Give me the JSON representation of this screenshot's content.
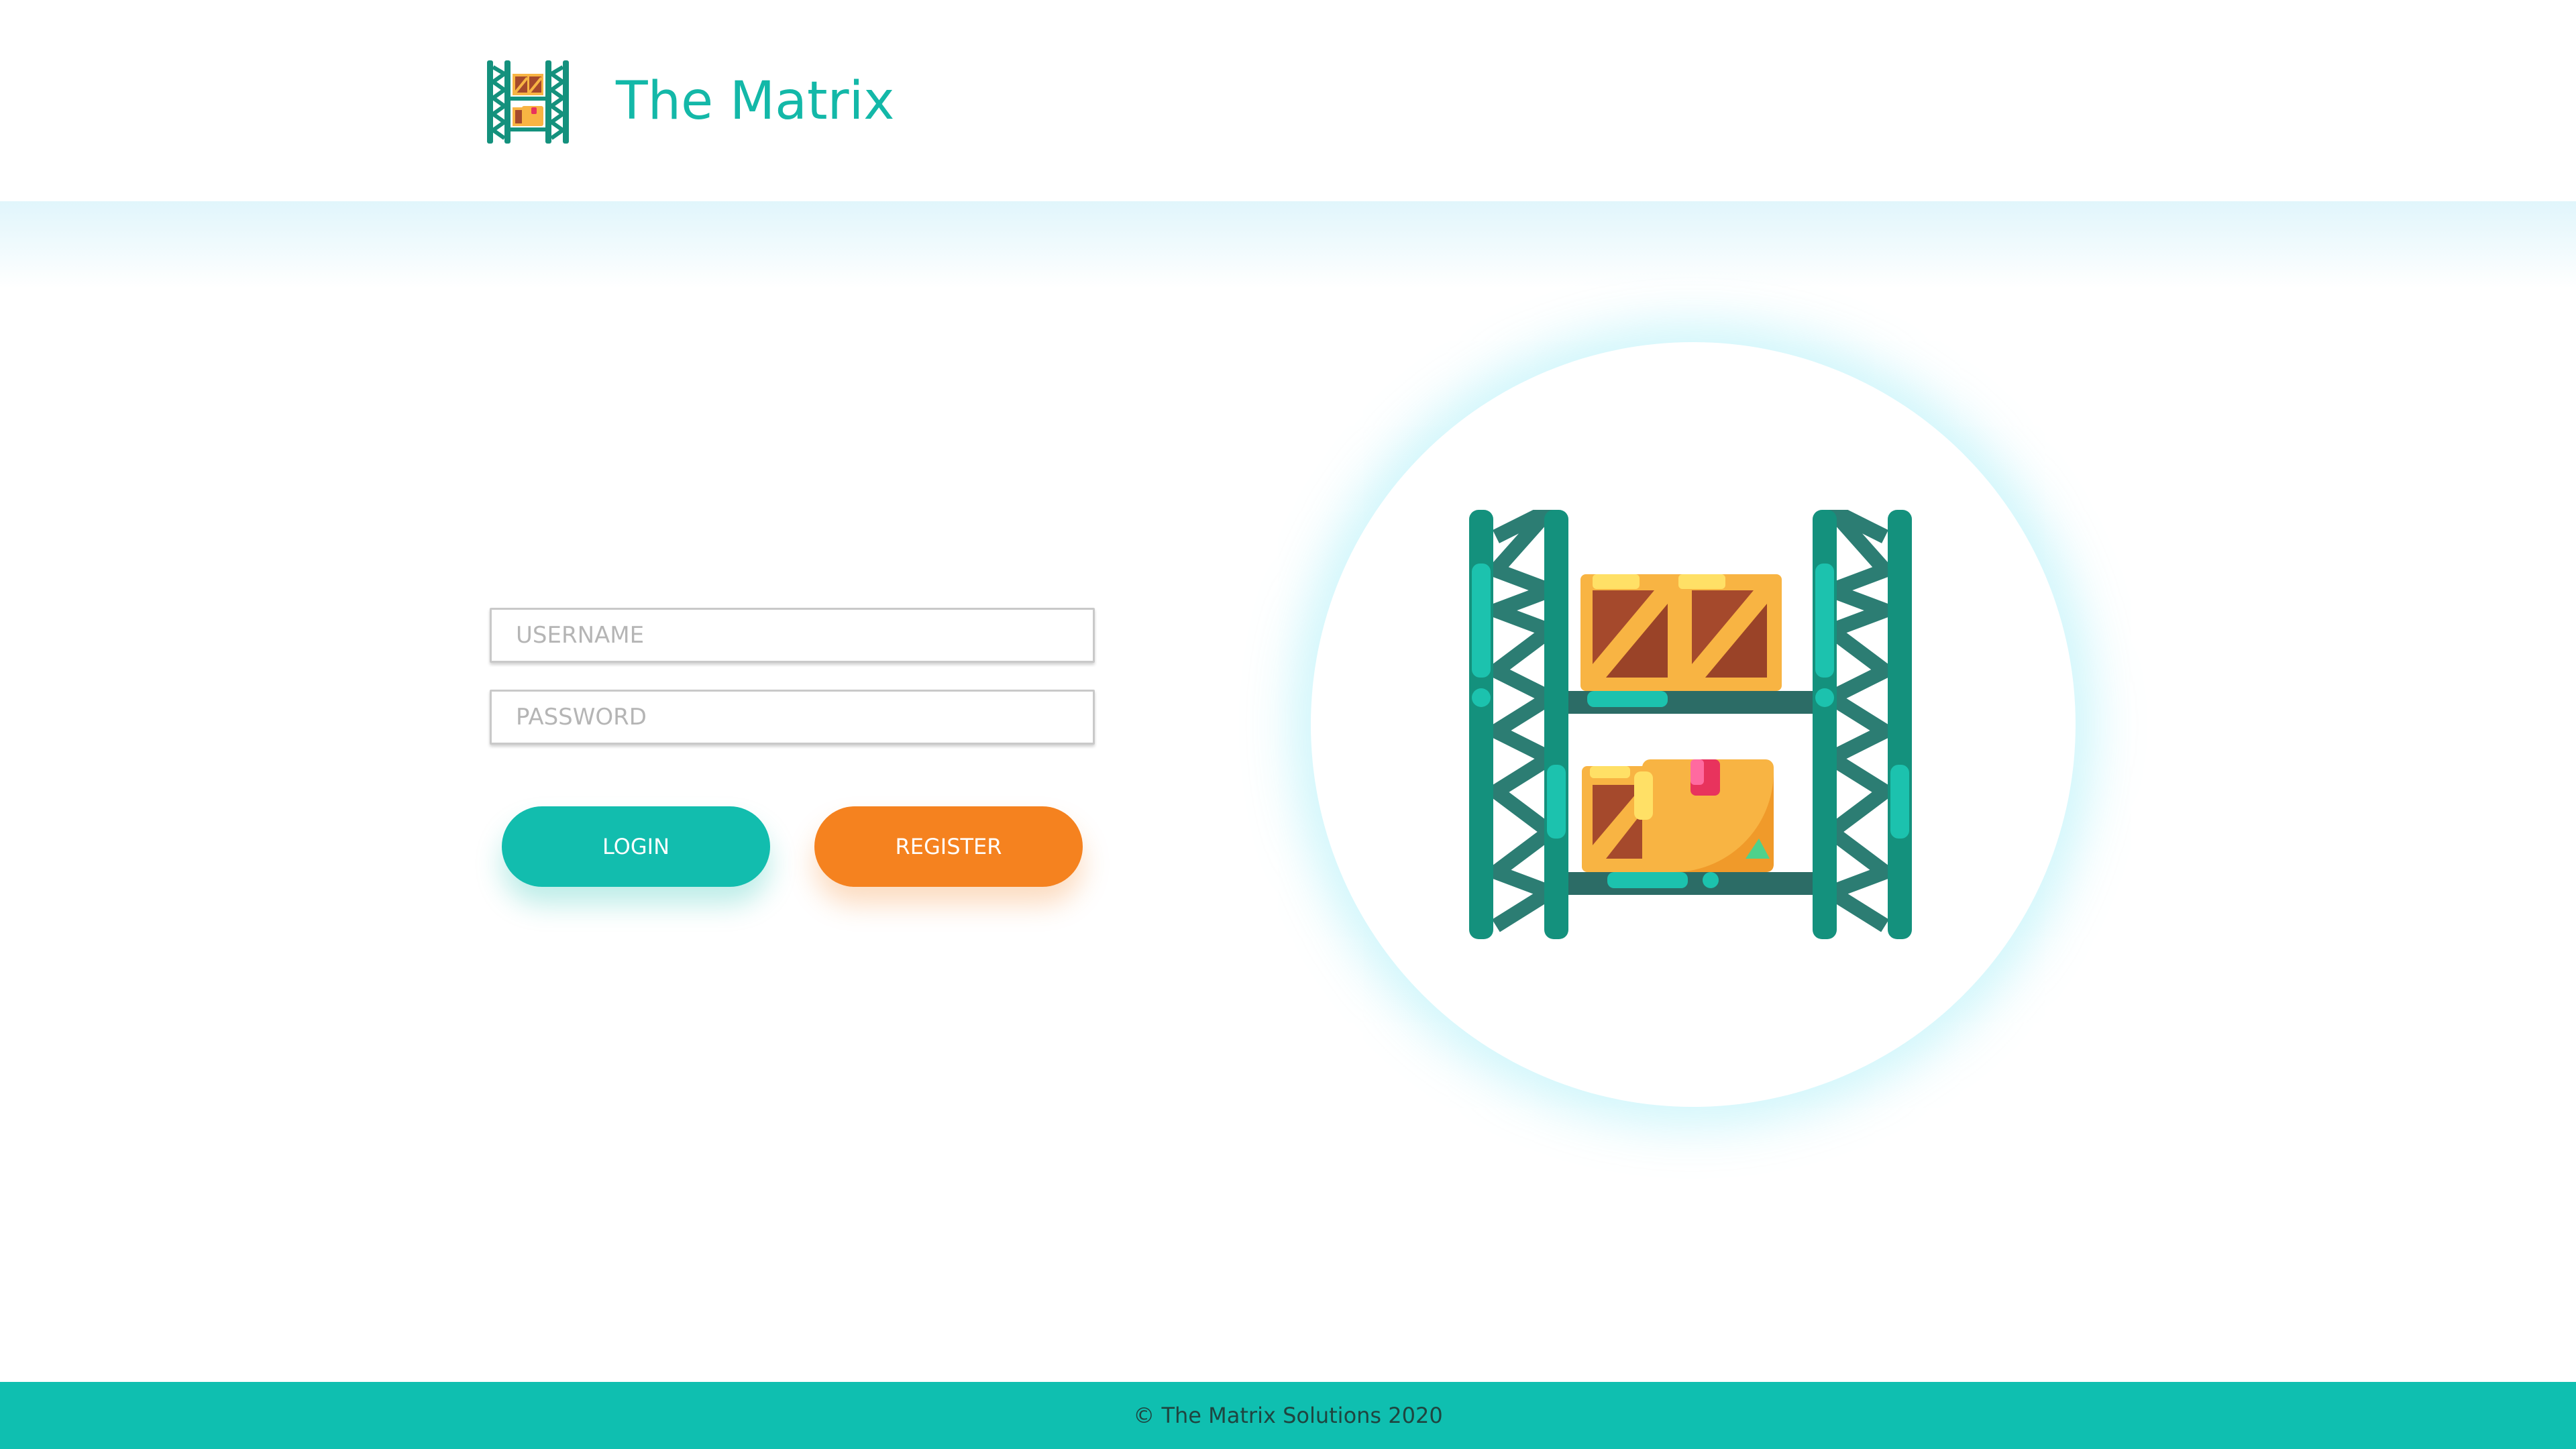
{
  "header": {
    "title": "The Matrix",
    "logo_icon": "warehouse-rack-icon"
  },
  "login_form": {
    "username": {
      "placeholder": "USERNAME",
      "value": ""
    },
    "password": {
      "placeholder": "PASSWORD",
      "value": ""
    },
    "login_label": "LOGIN",
    "register_label": "REGISTER"
  },
  "illustration": {
    "icon": "warehouse-shelf-icon"
  },
  "footer": {
    "text": "© The Matrix Solutions 2020"
  },
  "colors": {
    "brand_teal": "#13b8a8",
    "register_orange": "#f5821f",
    "footer_bg": "#0fbfb0",
    "rack_green": "#14917d",
    "box_orange": "#f8b443",
    "box_brown": "#a5492c"
  }
}
